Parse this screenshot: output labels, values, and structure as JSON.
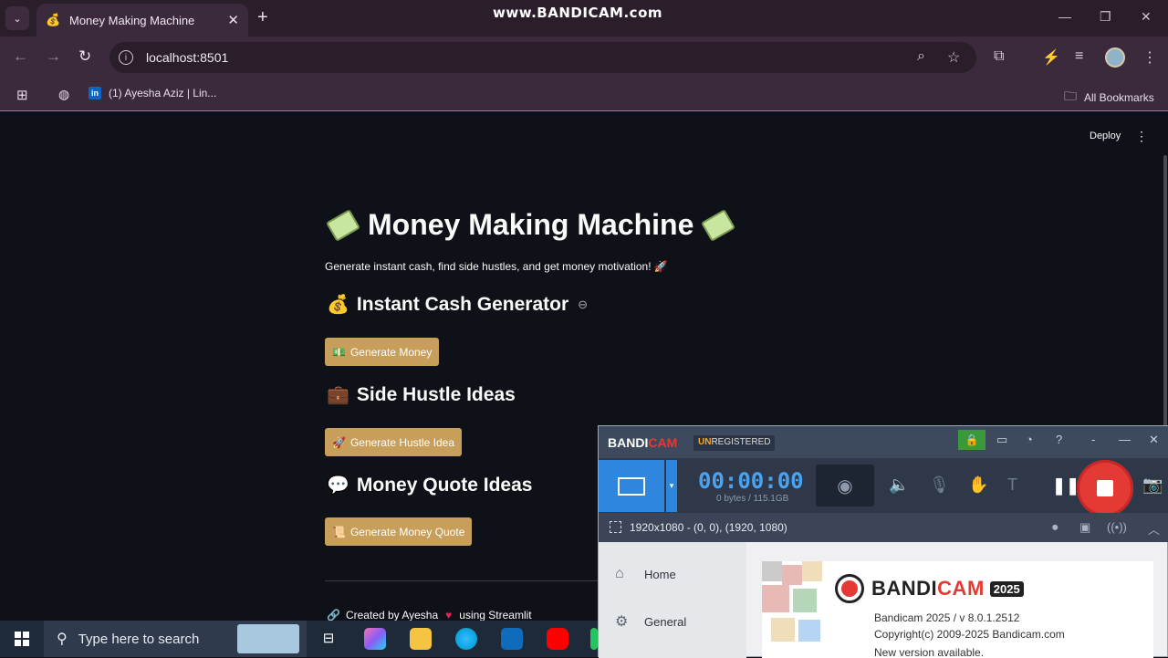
{
  "browser": {
    "tab_title": "Money Making Machine",
    "watermark": "www.BANDICAM.com",
    "url": "localhost:8501",
    "bookmarks": [
      "(1) Ayesha Aziz | Lin..."
    ],
    "all_bookmarks": "All Bookmarks"
  },
  "streamlit": {
    "deploy": "Deploy",
    "title": "Money Making Machine",
    "subtitle": "Generate instant cash, find side hustles, and get money motivation! 🚀",
    "sections": [
      {
        "heading": "Instant Cash Generator",
        "icon": "💰",
        "button": "Generate Money",
        "button_icon": "💵"
      },
      {
        "heading": "Side Hustle Ideas",
        "icon": "💼",
        "button": "Generate Hustle Idea",
        "button_icon": "🚀"
      },
      {
        "heading": "Money Quote Ideas",
        "icon": "💬",
        "button": "Generate Money Quote",
        "button_icon": "📜"
      }
    ],
    "footer_prefix": "Created by Ayesha",
    "footer_suffix": "using Streamlit"
  },
  "bandicam": {
    "logo_a": "BANDI",
    "logo_b": "CAM",
    "unreg_a": "UN",
    "unreg_b": "REGISTERED",
    "timer": "00:00:00",
    "size": "0 bytes / 115.1GB",
    "resolution": "1920x1080 - (0, 0), (1920, 1080)",
    "nav": [
      "Home",
      "General"
    ],
    "brand_a": "BANDI",
    "brand_b": "CAM",
    "brand_year": "2025",
    "version": "Bandicam 2025 / v 8.0.1.2512",
    "copyright": "Copyright(c) 2009-2025 Bandicam.com",
    "new_version": "New version available."
  },
  "taskbar": {
    "search_placeholder": "Type here to search"
  },
  "colors": {
    "button": "#c79e5a",
    "record": "#e53935",
    "streamlit_bg": "#0e1117"
  }
}
